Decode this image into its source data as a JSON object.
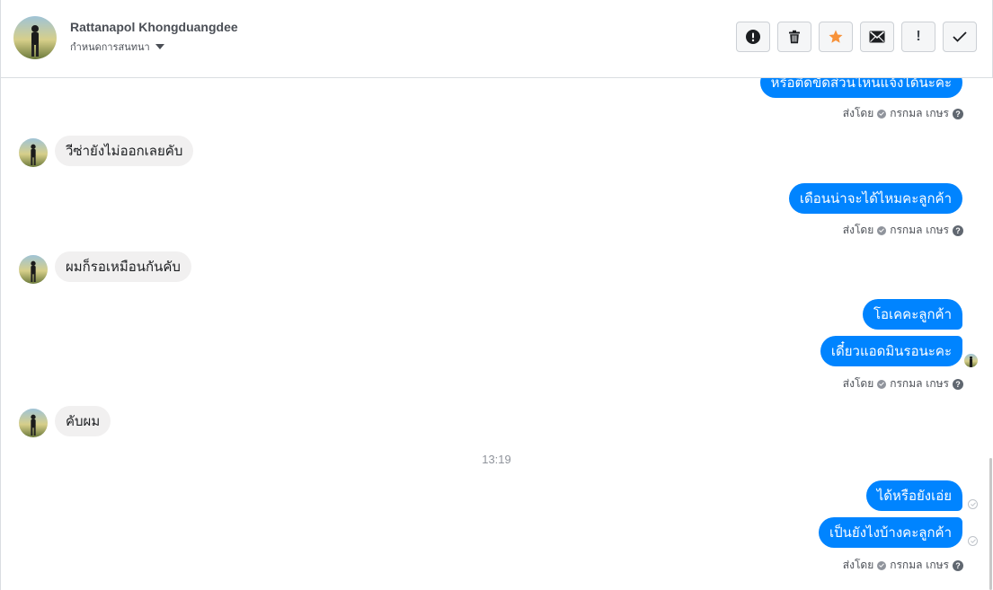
{
  "header": {
    "name": "Rattanapol Khongduangdee",
    "assign_label": "กำหนดการสนทนา"
  },
  "toolbar": {
    "icons": [
      "spam-icon",
      "trash-icon",
      "star-icon",
      "envelope-icon",
      "exclamation-icon",
      "check-icon"
    ],
    "star_color": "#f7923a"
  },
  "messages": [
    {
      "side": "out",
      "text": "หรือติดขัดส่วนไหนแจ้งได้นะคะ"
    },
    {
      "side": "in",
      "text": "วีซ่ายังไม่ออกเลยคับ"
    },
    {
      "side": "out",
      "text": "เดือนน่าจะได้ไหมคะลูกค้า"
    },
    {
      "side": "in",
      "text": "ผมก็รอเหมือนกันคับ"
    },
    {
      "side": "out",
      "text": "โอเคคะลูกค้า"
    },
    {
      "side": "out",
      "text": "เดี๋ยวแอดมินรอนะคะ"
    },
    {
      "side": "in",
      "text": "คับผม"
    },
    {
      "side": "out",
      "text": "ได้หรือยังเอ่ย"
    },
    {
      "side": "out",
      "text": "เป็นยังไงบ้างคะลูกค้า"
    }
  ],
  "sent_by": {
    "prefix": "ส่งโดย",
    "agent": "กรกมล เกษร"
  },
  "timestamp": "13:19",
  "colors": {
    "outgoing_bubble": "#0084ff",
    "incoming_bubble": "#f1f0f0"
  }
}
